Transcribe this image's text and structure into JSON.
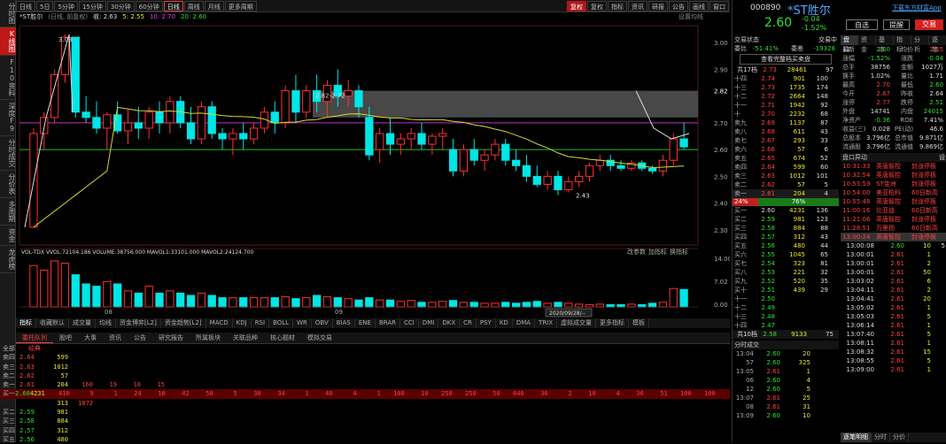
{
  "left_tabs": [
    "分时图",
    "K线图",
    "F10资料",
    "深度F9",
    "分时成交",
    "分价表",
    "多周期",
    "资金",
    "龙虎榜"
  ],
  "toolbar": [
    "日线",
    "5日",
    "5分钟",
    "15分钟",
    "30分钟",
    "60分钟",
    "日线",
    "周线",
    "月线",
    "更多周期",
    "复权",
    "复权",
    "指标",
    "资讯",
    "研报",
    "公告",
    "画线",
    "窗口"
  ],
  "info": {
    "name": "*ST胜尔",
    "fq": "(日线, 前复权)",
    "close": "收: 2.63",
    "ma5": "5: 2.55",
    "ma10": "10: 2.70",
    "ma20": "20: 2.60",
    "settings": "设置均线"
  },
  "chart_data": {
    "type": "candlestick",
    "yaxis": [
      "3.00",
      "2.90",
      "2.82",
      "2.70",
      "2.60",
      "2.50",
      "2.40",
      "2.30"
    ],
    "annotations": [
      "3.03",
      "2.82-2.72",
      "2.43"
    ],
    "vol_info": "VOL-TDX  VVOL:72104.186  VOLUME:38756.000  MAVOL1:33101.000  MAVOL2:24124.700",
    "vol_axis": [
      "14.00",
      "7.02",
      "0.00"
    ],
    "vol_right": [
      "改参数",
      "加指标",
      "换指标"
    ],
    "xlabels": [
      "08",
      "09"
    ],
    "cursor_date": "2020/09/28/--"
  },
  "ind_tabs": [
    "指标",
    "收藏默认",
    "成交量",
    "均线",
    "资金博弈[L2]",
    "资金趋势[L2]",
    "MACD",
    "KDJ",
    "RSI",
    "BOLL",
    "WR",
    "OBV",
    "BIAS",
    "ENE",
    "BRAR",
    "CCI",
    "DMI",
    "DKX",
    "CR",
    "PSY",
    "KD",
    "DMA",
    "TRIX",
    "虚拟成交量",
    "更多指标",
    "模板"
  ],
  "bottom_tabs": [
    "委托队列",
    "股吧",
    "大事",
    "资讯",
    "公告",
    "研究报告",
    "所属板块",
    "关联品种",
    "核心题材",
    "模拟交易"
  ],
  "order_queue": {
    "header": [
      "全部",
      "经典"
    ],
    "rows": [
      {
        "l": "卖四",
        "p": "2.64",
        "v": "599",
        "q": []
      },
      {
        "l": "卖三",
        "p": "2.63",
        "v": "1012",
        "q": []
      },
      {
        "l": "卖二",
        "p": "2.62",
        "v": "57",
        "q": []
      },
      {
        "l": "卖一",
        "p": "2.61",
        "v": "204",
        "q": [
          "160",
          "19",
          "10",
          "15"
        ]
      },
      {
        "l": "买一",
        "p": "2.60",
        "v": "4231",
        "q": [
          "410",
          "9",
          "1",
          "24",
          "10",
          "42",
          "50",
          "5",
          "30",
          "34",
          "1",
          "48",
          "4",
          "1",
          "100",
          "10",
          "258",
          "250",
          "50",
          "646",
          "36",
          "2",
          "10",
          "4",
          "36",
          "51",
          "100",
          "100",
          "15"
        ]
      },
      {
        "l": "",
        "p": "",
        "v": "313",
        "q": [
          "1872"
        ]
      },
      {
        "l": "买二",
        "p": "2.59",
        "v": "981",
        "q": []
      },
      {
        "l": "买三",
        "p": "2.58",
        "v": "884",
        "q": []
      },
      {
        "l": "买四",
        "p": "2.57",
        "v": "312",
        "q": []
      },
      {
        "l": "买五",
        "p": "2.56",
        "v": "480",
        "q": []
      }
    ]
  },
  "quote": {
    "code": "000890",
    "name": "*ST胜尔",
    "app": "下载东方财富App",
    "price": "2.60",
    "chg": "-0.04",
    "pct": "-1.52%",
    "btn_self": "自选",
    "btn_alert": "提醒",
    "btn_trade": "交易"
  },
  "tabs_r": [
    "盘口",
    "资金",
    "基本",
    "指标",
    "分析",
    "逐笔"
  ],
  "status": {
    "label": "交易状态",
    "value": "交易中",
    "wb": "委比",
    "wbv": "-51.41%",
    "wc": "委差",
    "wcv": "-19328",
    "view": "查看完整档买卖盘",
    "total": "共17档",
    "tp": "2.73",
    "tv": "28461",
    "tn": "97"
  },
  "asks": [
    [
      "十四",
      "2.74",
      "901",
      "100"
    ],
    [
      "十三",
      "2.73",
      "1735",
      "174"
    ],
    [
      "十二",
      "2.72",
      "2664",
      "148"
    ],
    [
      "十一",
      "2.71",
      "1942",
      "92"
    ],
    [
      "十",
      "2.70",
      "2232",
      "68"
    ],
    [
      "卖九",
      "2.69",
      "1137",
      "87"
    ],
    [
      "卖八",
      "2.68",
      "611",
      "43"
    ],
    [
      "卖七",
      "2.67",
      "293",
      "33"
    ],
    [
      "卖六",
      "2.66",
      "57",
      "6"
    ],
    [
      "卖五",
      "2.65",
      "674",
      "52"
    ],
    [
      "卖四",
      "2.64",
      "599",
      "60"
    ],
    [
      "卖三",
      "2.63",
      "1012",
      "101"
    ],
    [
      "卖二",
      "2.62",
      "57",
      "5"
    ],
    [
      "卖一",
      "2.61",
      "204",
      "4"
    ]
  ],
  "ratio": {
    "l": "24%",
    "r": "76%"
  },
  "bids": [
    [
      "买一",
      "2.60",
      "4231",
      "136"
    ],
    [
      "买二",
      "2.59",
      "981",
      "123"
    ],
    [
      "买三",
      "2.58",
      "884",
      "88"
    ],
    [
      "买四",
      "2.57",
      "312",
      "43"
    ],
    [
      "买五",
      "2.56",
      "480",
      "44"
    ],
    [
      "买六",
      "2.55",
      "1045",
      "65"
    ],
    [
      "买七",
      "2.54",
      "323",
      "81"
    ],
    [
      "买八",
      "2.53",
      "221",
      "32"
    ],
    [
      "买九",
      "2.52",
      "520",
      "35"
    ],
    [
      "买十",
      "2.51",
      "439",
      "29"
    ],
    [
      "十一",
      "2.50",
      "",
      ""
    ],
    [
      "十二",
      "2.49",
      "",
      ""
    ],
    [
      "十三",
      "2.48",
      "",
      ""
    ],
    [
      "十四",
      "2.47",
      "",
      ""
    ]
  ],
  "bid_total": {
    "label": "共10档",
    "p": "2.58",
    "v": "9133",
    "n": "75"
  },
  "stats": [
    [
      "最新",
      "2.60",
      "均价",
      "2.65"
    ],
    [
      "涨幅",
      "-1.52%",
      "涨跌",
      "-0.04"
    ],
    [
      "总手",
      "38756",
      "金额",
      "1027万"
    ],
    [
      "换手",
      "1.02%",
      "量比",
      "1.71"
    ],
    [
      "最高",
      "2.70",
      "最低",
      "2.60"
    ],
    [
      "今开",
      "2.67",
      "昨收",
      "2.64"
    ],
    [
      "涨停",
      "2.77",
      "跌停",
      "2.51"
    ],
    [
      "外盘",
      "14741",
      "内盘",
      "24015"
    ],
    [
      "净资产",
      "-0.36",
      "ROE",
      "7.41%"
    ],
    [
      "收益(三)",
      "0.028",
      "PE(动)",
      "46.6"
    ],
    [
      "总股本",
      "3.796亿",
      "总市值",
      "9.871亿"
    ],
    [
      "流通股",
      "3.796亿",
      "流通值",
      "9.869亿"
    ]
  ],
  "moves_title": "盘口异动",
  "moves_btn": "设",
  "moves": [
    [
      "10:31:33",
      "英唐智控",
      "封涨停板"
    ],
    [
      "10:32:54",
      "英唐智控",
      "封涨停板"
    ],
    [
      "10:53:59",
      "ST金洲",
      "封涨停板"
    ],
    [
      "10:54:00",
      "美亚柏科",
      "60日新高"
    ],
    [
      "10:55:48",
      "英唐智控",
      "封涨停板"
    ],
    [
      "11:00:16",
      "比亚迪",
      "60日新高"
    ],
    [
      "11:21:06",
      "英唐智控",
      "封涨停板"
    ],
    [
      "11:28:51",
      "万里扬",
      "60日新高"
    ],
    [
      "13:00:24",
      "英唐智控",
      "封涨停板"
    ]
  ],
  "ticks_right": [
    [
      "13:00:08",
      "2.60",
      "10",
      "5"
    ],
    [
      "13:00:01",
      "2.61",
      "1",
      ""
    ],
    [
      "13:00:01",
      "2.61",
      "2",
      ""
    ],
    [
      "13:00:01",
      "2.61",
      "50",
      ""
    ],
    [
      "13:03:02",
      "2.61",
      "6",
      ""
    ],
    [
      "13:04:11",
      "2.61",
      "2",
      ""
    ],
    [
      "13:04:41",
      "2.61",
      "20",
      ""
    ],
    [
      "13:05:02",
      "2.61",
      "1",
      ""
    ],
    [
      "13:05:03",
      "2.61",
      "5",
      ""
    ],
    [
      "13:06:14",
      "2.61",
      "1",
      ""
    ],
    [
      "13:07:40",
      "2.61",
      "5",
      ""
    ],
    [
      "13:08:11",
      "2.61",
      "1",
      ""
    ],
    [
      "13:08:32",
      "2.61",
      "15",
      ""
    ],
    [
      "13:08:55",
      "2.61",
      "5",
      ""
    ],
    [
      "13:09:00",
      "2.61",
      "1",
      ""
    ]
  ],
  "ticks_left_title": "分时成交",
  "ticks_left": [
    [
      "13:04",
      "2.60",
      "20",
      ""
    ],
    [
      "57",
      "2.60",
      "325",
      ""
    ],
    [
      "13:05",
      "2.61",
      "1",
      ""
    ],
    [
      "06",
      "2.60",
      "4",
      ""
    ],
    [
      "12",
      "2.60",
      "5",
      ""
    ],
    [
      "13:07",
      "2.61",
      "25",
      ""
    ],
    [
      "08",
      "2.61",
      "31",
      ""
    ],
    [
      "13:09",
      "2.60",
      "10",
      ""
    ]
  ],
  "tick_tabs": [
    "逐笔明细",
    "分时",
    "分价"
  ]
}
